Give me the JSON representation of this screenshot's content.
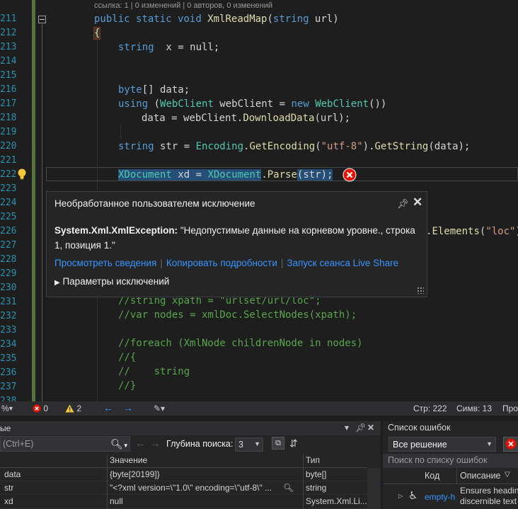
{
  "editor": {
    "codelens": "ссылка: 1 | 0 изменений | 0 авторов, 0 изменений",
    "line_numbers": [
      "211",
      "212",
      "213",
      "214",
      "215",
      "216",
      "217",
      "218",
      "219",
      "220",
      "221",
      "222",
      "223",
      "224",
      "225",
      "226",
      "227",
      "228",
      "229",
      "230",
      "231",
      "232",
      "233",
      "234",
      "235",
      "236",
      "237",
      "238"
    ],
    "lines": {
      "l211": {
        "kw1": "public",
        "kw2": "static",
        "kw3": "void",
        "fn": "XmlReadMap",
        "open": "(",
        "kw4": "string",
        "arg": " url)"
      },
      "l212": "{",
      "l213": {
        "kw": "string",
        "rest": "  x = null;"
      },
      "l216": {
        "kw": "byte",
        "rest": "[] data;"
      },
      "l217": {
        "kw": "using",
        "p1": " (",
        "ty1": "WebClient",
        "var": " webClient",
        "eq": " = ",
        "kw2": "new",
        "sp": " ",
        "ty2": "WebClient",
        "end": "())"
      },
      "l218": {
        "var": "data",
        "eq": " = ",
        "obj": "webClient",
        "dot": ".",
        "fn": "DownloadData",
        "end": "(url);"
      },
      "l220": {
        "kw": "string",
        "var": " str",
        "eq": " = ",
        "ty": "Encoding",
        "dot": ".",
        "fn": "GetEncoding",
        "p": "(",
        "str": "\"utf-8\"",
        "p2": ").",
        "fn2": "GetString",
        "end": "(data);"
      },
      "l222": {
        "ty1": "XDocument",
        "var": " xd",
        "eq": " = ",
        "ty2": "XDocument",
        "dot": ".",
        "fn": "Parse",
        "end": "(str);"
      },
      "l226": {
        "dot": ".",
        "fn": "Elements",
        "p": "(",
        "str": "\"loc\"",
        "end": ")"
      },
      "l231": "//string xpath = \"urlset/url/loc\";",
      "l232": "//var nodes = xmlDoc.SelectNodes(xpath);",
      "l234": "//foreach (XmlNode childrenNode in nodes)",
      "l235": "//{",
      "l236": "//    string",
      "l237": "//}"
    }
  },
  "exception_popup": {
    "title": "Необработанное пользователем исключение",
    "type": "System.Xml.XmlException:",
    "message": " \"Недопустимые данные на корневом уровне., строка 1, позиция 1.\"",
    "link_details": "Просмотреть сведения",
    "link_copy": "Копировать подробности",
    "link_liveshare": "Запуск сеанса Live Share",
    "settings": "Параметры исключений",
    "pin_icon": "pin-icon",
    "close_icon": "close-icon"
  },
  "status_bar": {
    "zoom": "%",
    "errors": "0",
    "warnings": "2",
    "line": "Стр: 222",
    "col": "Симв: 13",
    "spaces": "Про"
  },
  "locals": {
    "tab_label": "ые",
    "search_placeholder": "(Ctrl+E)",
    "depth_label": "Глубина поиска:",
    "depth_value": "3",
    "columns": [
      "",
      "Значение",
      "Тип"
    ],
    "rows": [
      {
        "name": "data",
        "value": "{byte[20199]}",
        "type": "byte[]"
      },
      {
        "name": "str",
        "value": "\"<?xml version=\\\"1.0\\\" encoding=\\\"utf-8\\\" ...",
        "type": "string"
      },
      {
        "name": "xd",
        "value": "null",
        "type": "System.Xml.Li..."
      }
    ]
  },
  "error_list": {
    "title": "Список ошибок",
    "scope": "Все решение",
    "search_placeholder": "Поиск по списку ошибок",
    "col_code": "Код",
    "col_description": "Описание",
    "row_code": "empty-h",
    "row_desc_1": "Ensures heading",
    "row_desc_2": "discernible text"
  },
  "colors": {
    "accent_link": "#3794ff",
    "error_red": "#e51400",
    "warning_yellow": "#f5c73b"
  }
}
